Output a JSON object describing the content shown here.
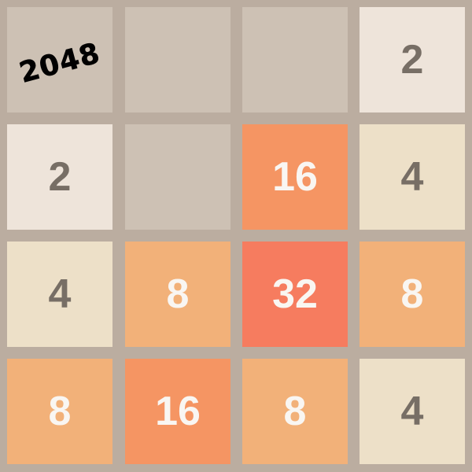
{
  "game": {
    "logo_text": "2048"
  },
  "board": {
    "rows": [
      [
        "",
        "",
        "",
        "2"
      ],
      [
        "2",
        "",
        "16",
        "4"
      ],
      [
        "4",
        "8",
        "32",
        "8"
      ],
      [
        "8",
        "16",
        "8",
        "4"
      ]
    ]
  },
  "colors": {
    "board_background": "#bbada0",
    "empty_cell": "#cdc1b4",
    "tile_2": "#eee4da",
    "tile_4": "#ede0c8",
    "tile_8": "#f2b179",
    "tile_16": "#f59563",
    "tile_32": "#f67c5f",
    "dark_text": "#776e65",
    "light_text": "#f9f6f2"
  }
}
